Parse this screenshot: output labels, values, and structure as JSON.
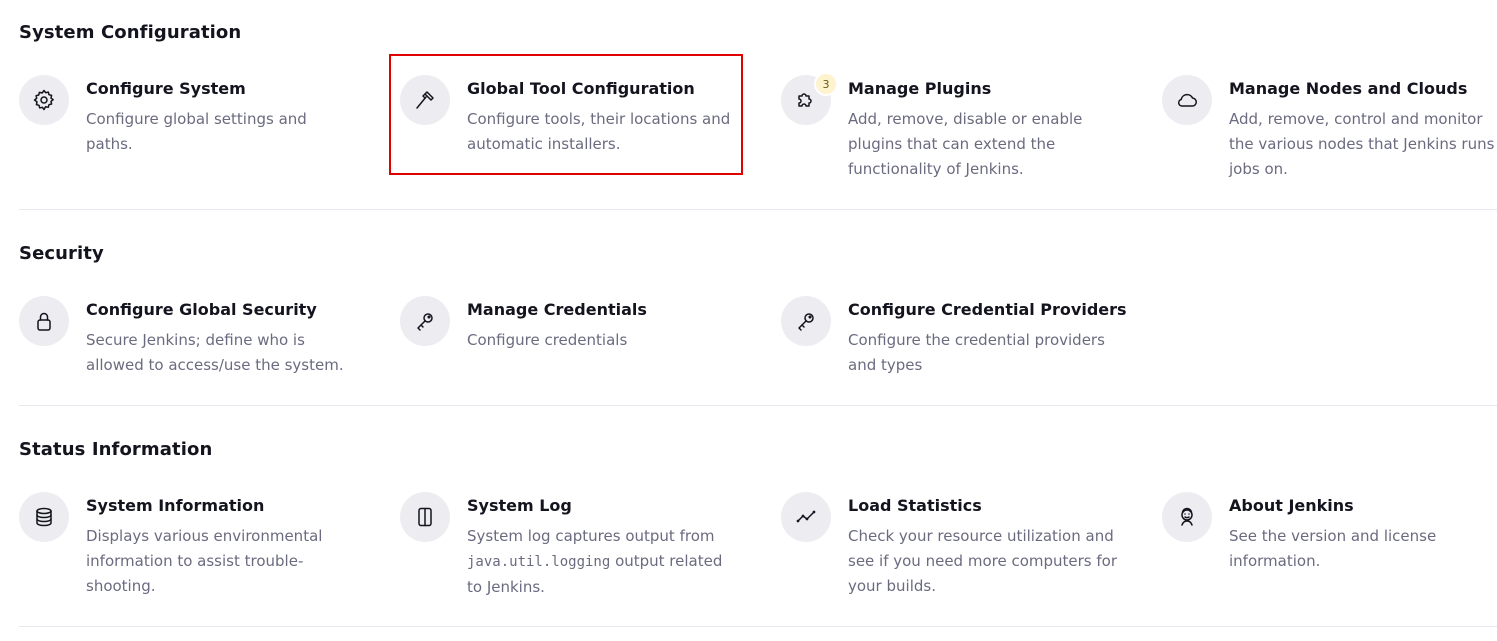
{
  "sections": [
    {
      "title": "System Configuration",
      "items": [
        {
          "title": "Configure System",
          "desc": "Configure global settings and paths.",
          "icon": "gear-icon"
        },
        {
          "title": "Global Tool Configuration",
          "desc": "Configure tools, their locations and automatic installers.",
          "icon": "hammer-icon"
        },
        {
          "title": "Manage Plugins",
          "desc": "Add, remove, disable or enable plugins that can extend the functionality of Jenkins.",
          "icon": "puzzle-icon",
          "badge": "3"
        },
        {
          "title": "Manage Nodes and Clouds",
          "desc": "Add, remove, control and monitor the various nodes that Jenkins runs jobs on.",
          "icon": "cloud-icon"
        }
      ]
    },
    {
      "title": "Security",
      "items": [
        {
          "title": "Configure Global Security",
          "desc": "Secure Jenkins; define who is allowed to access/use the system.",
          "icon": "lock-icon"
        },
        {
          "title": "Manage Credentials",
          "desc": "Configure credentials",
          "icon": "key-icon"
        },
        {
          "title": "Configure Credential Providers",
          "desc": "Configure the credential providers and types",
          "icon": "key-icon"
        }
      ]
    },
    {
      "title": "Status Information",
      "items": [
        {
          "title": "System Information",
          "desc": "Displays various environmental information to assist trouble-shooting.",
          "icon": "database-icon"
        },
        {
          "title": "System Log",
          "desc_pre": "System log captures output from ",
          "desc_code": "java.util.logging",
          "desc_post": " output related to Jenkins.",
          "icon": "log-icon"
        },
        {
          "title": "Load Statistics",
          "desc": "Check your resource utilization and see if you need more computers for your builds.",
          "icon": "chart-line-icon"
        },
        {
          "title": "About Jenkins",
          "desc": "See the version and license information.",
          "icon": "jenkins-icon"
        }
      ]
    }
  ],
  "highlight_color": "#e00000"
}
